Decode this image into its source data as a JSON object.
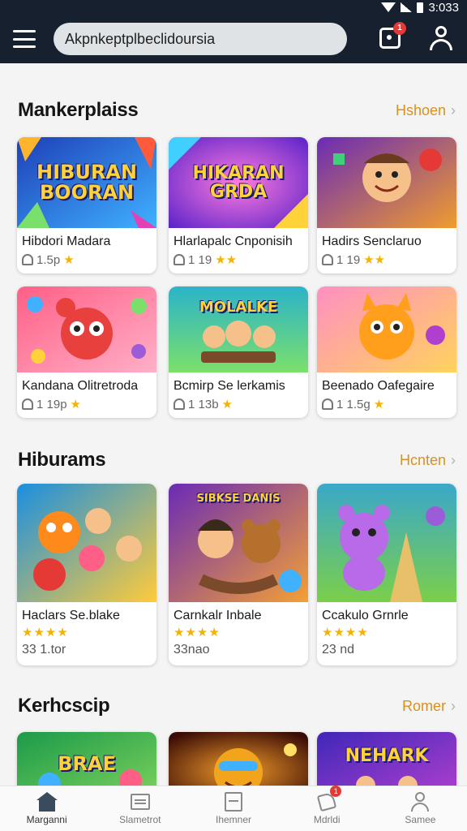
{
  "status_bar": {
    "time": "3:033",
    "icons": [
      "wifi-icon",
      "signal-icon",
      "battery-icon"
    ]
  },
  "app_bar": {
    "search_value": "Akpnkeptplbeclidoursia",
    "cart_badge": "1",
    "icons": [
      "menu-icon",
      "bag-icon",
      "user-icon"
    ]
  },
  "sections": [
    {
      "title": "Mankerplaiss",
      "more": "Hshoen",
      "cards": [
        {
          "title": "Hibdori Madara",
          "rating": "1.5p",
          "art_text": "HIBURAN\nBOORAN",
          "bg": [
            "#1e5bd8",
            "#3fb1ff"
          ]
        },
        {
          "title": "Hlarlapalc Cnponisih",
          "rating": "1 19",
          "art_text": "HIKARAN\nGRDA",
          "bg": [
            "#6b2bd9",
            "#e43fb5"
          ]
        },
        {
          "title": "Hadirs Senclaruo",
          "rating": "1 19",
          "art_text": "",
          "bg": [
            "#7b36c9",
            "#f09c2e"
          ]
        },
        {
          "title": "Kandana Olitretroda",
          "rating": "1 19p",
          "art_text": "",
          "bg": [
            "#ff6b8a",
            "#ffb0c8"
          ]
        },
        {
          "title": "Bcmirp Se lerkamis",
          "rating": "1 13b",
          "art_text": "MOLALKE",
          "bg": [
            "#2bb3c9",
            "#7be06b"
          ]
        },
        {
          "title": "Beenado Oafegaire",
          "rating": "1 1.5g",
          "art_text": "",
          "bg": [
            "#ff8fc2",
            "#ffd35c"
          ]
        }
      ]
    },
    {
      "title": "Hiburams",
      "more": "Hcnten",
      "cards": [
        {
          "title": "Haclars Se.blake",
          "stars": "★★★★",
          "count": "33 1.tor",
          "bg": [
            "#1a8fe0",
            "#ffcb3b"
          ]
        },
        {
          "title": "Carnkalr Inbale",
          "stars": "★★★★",
          "count": "33nao",
          "art_text": "SIBKSE DANIS",
          "bg": [
            "#6a2bb5",
            "#f3a035"
          ]
        },
        {
          "title": "Ccakulo Grnrle",
          "stars": "★★★★",
          "count": "23 nd",
          "bg": [
            "#3aa85a",
            "#9fd65b"
          ]
        }
      ]
    },
    {
      "title": "Kerhcscip",
      "more": "Romer",
      "cards": [
        {
          "title": "",
          "art_text": "BRAE",
          "bg": [
            "#1c9a4a",
            "#7ad15b"
          ]
        },
        {
          "title": "",
          "art_text": "",
          "bg": [
            "#5a1a0c",
            "#f29b2b"
          ]
        },
        {
          "title": "",
          "art_text": "NEHARK",
          "bg": [
            "#3f27b8",
            "#b03fcf"
          ]
        }
      ]
    }
  ],
  "bottom_nav": [
    {
      "label": "Marganni",
      "icon": "home-icon",
      "active": true
    },
    {
      "label": "Slametrot",
      "icon": "store-icon"
    },
    {
      "label": "Ihemner",
      "icon": "document-icon"
    },
    {
      "label": "Mdrldi",
      "icon": "tag-icon",
      "badge": "1"
    },
    {
      "label": "Samee",
      "icon": "profile-icon"
    }
  ]
}
